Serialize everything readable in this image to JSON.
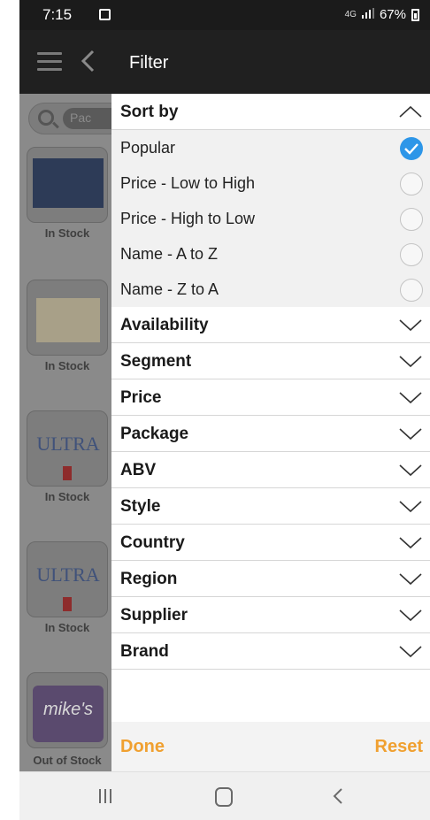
{
  "status_bar": {
    "time": "7:15",
    "network": "4G",
    "battery": "67%"
  },
  "app_bar": {
    "title": "Filter"
  },
  "background": {
    "search_chip": "Pac",
    "products": [
      {
        "stock": "In Stock",
        "art": "pernicious"
      },
      {
        "stock": "In Stock",
        "art": "bottles"
      },
      {
        "stock": "In Stock",
        "art": "ultra",
        "logo_text": "ULTRA"
      },
      {
        "stock": "In Stock",
        "art": "ultra",
        "logo_text": "ULTRA"
      },
      {
        "stock": "Out of Stock",
        "art": "mikes",
        "logo_text": "mike's"
      }
    ]
  },
  "filter": {
    "sort_by": {
      "label": "Sort by",
      "expanded": true,
      "options": [
        {
          "label": "Popular",
          "selected": true
        },
        {
          "label": "Price - Low to High",
          "selected": false
        },
        {
          "label": "Price - High to Low",
          "selected": false
        },
        {
          "label": "Name - A to Z",
          "selected": false
        },
        {
          "label": "Name - Z to A",
          "selected": false
        }
      ]
    },
    "sections": [
      {
        "label": "Availability"
      },
      {
        "label": "Segment"
      },
      {
        "label": "Price"
      },
      {
        "label": "Package"
      },
      {
        "label": "ABV"
      },
      {
        "label": "Style"
      },
      {
        "label": "Country"
      },
      {
        "label": "Region"
      },
      {
        "label": "Supplier"
      },
      {
        "label": "Brand"
      }
    ],
    "done_label": "Done",
    "reset_label": "Reset"
  },
  "colors": {
    "accent": "#f0a030",
    "check": "#2d96e8"
  }
}
